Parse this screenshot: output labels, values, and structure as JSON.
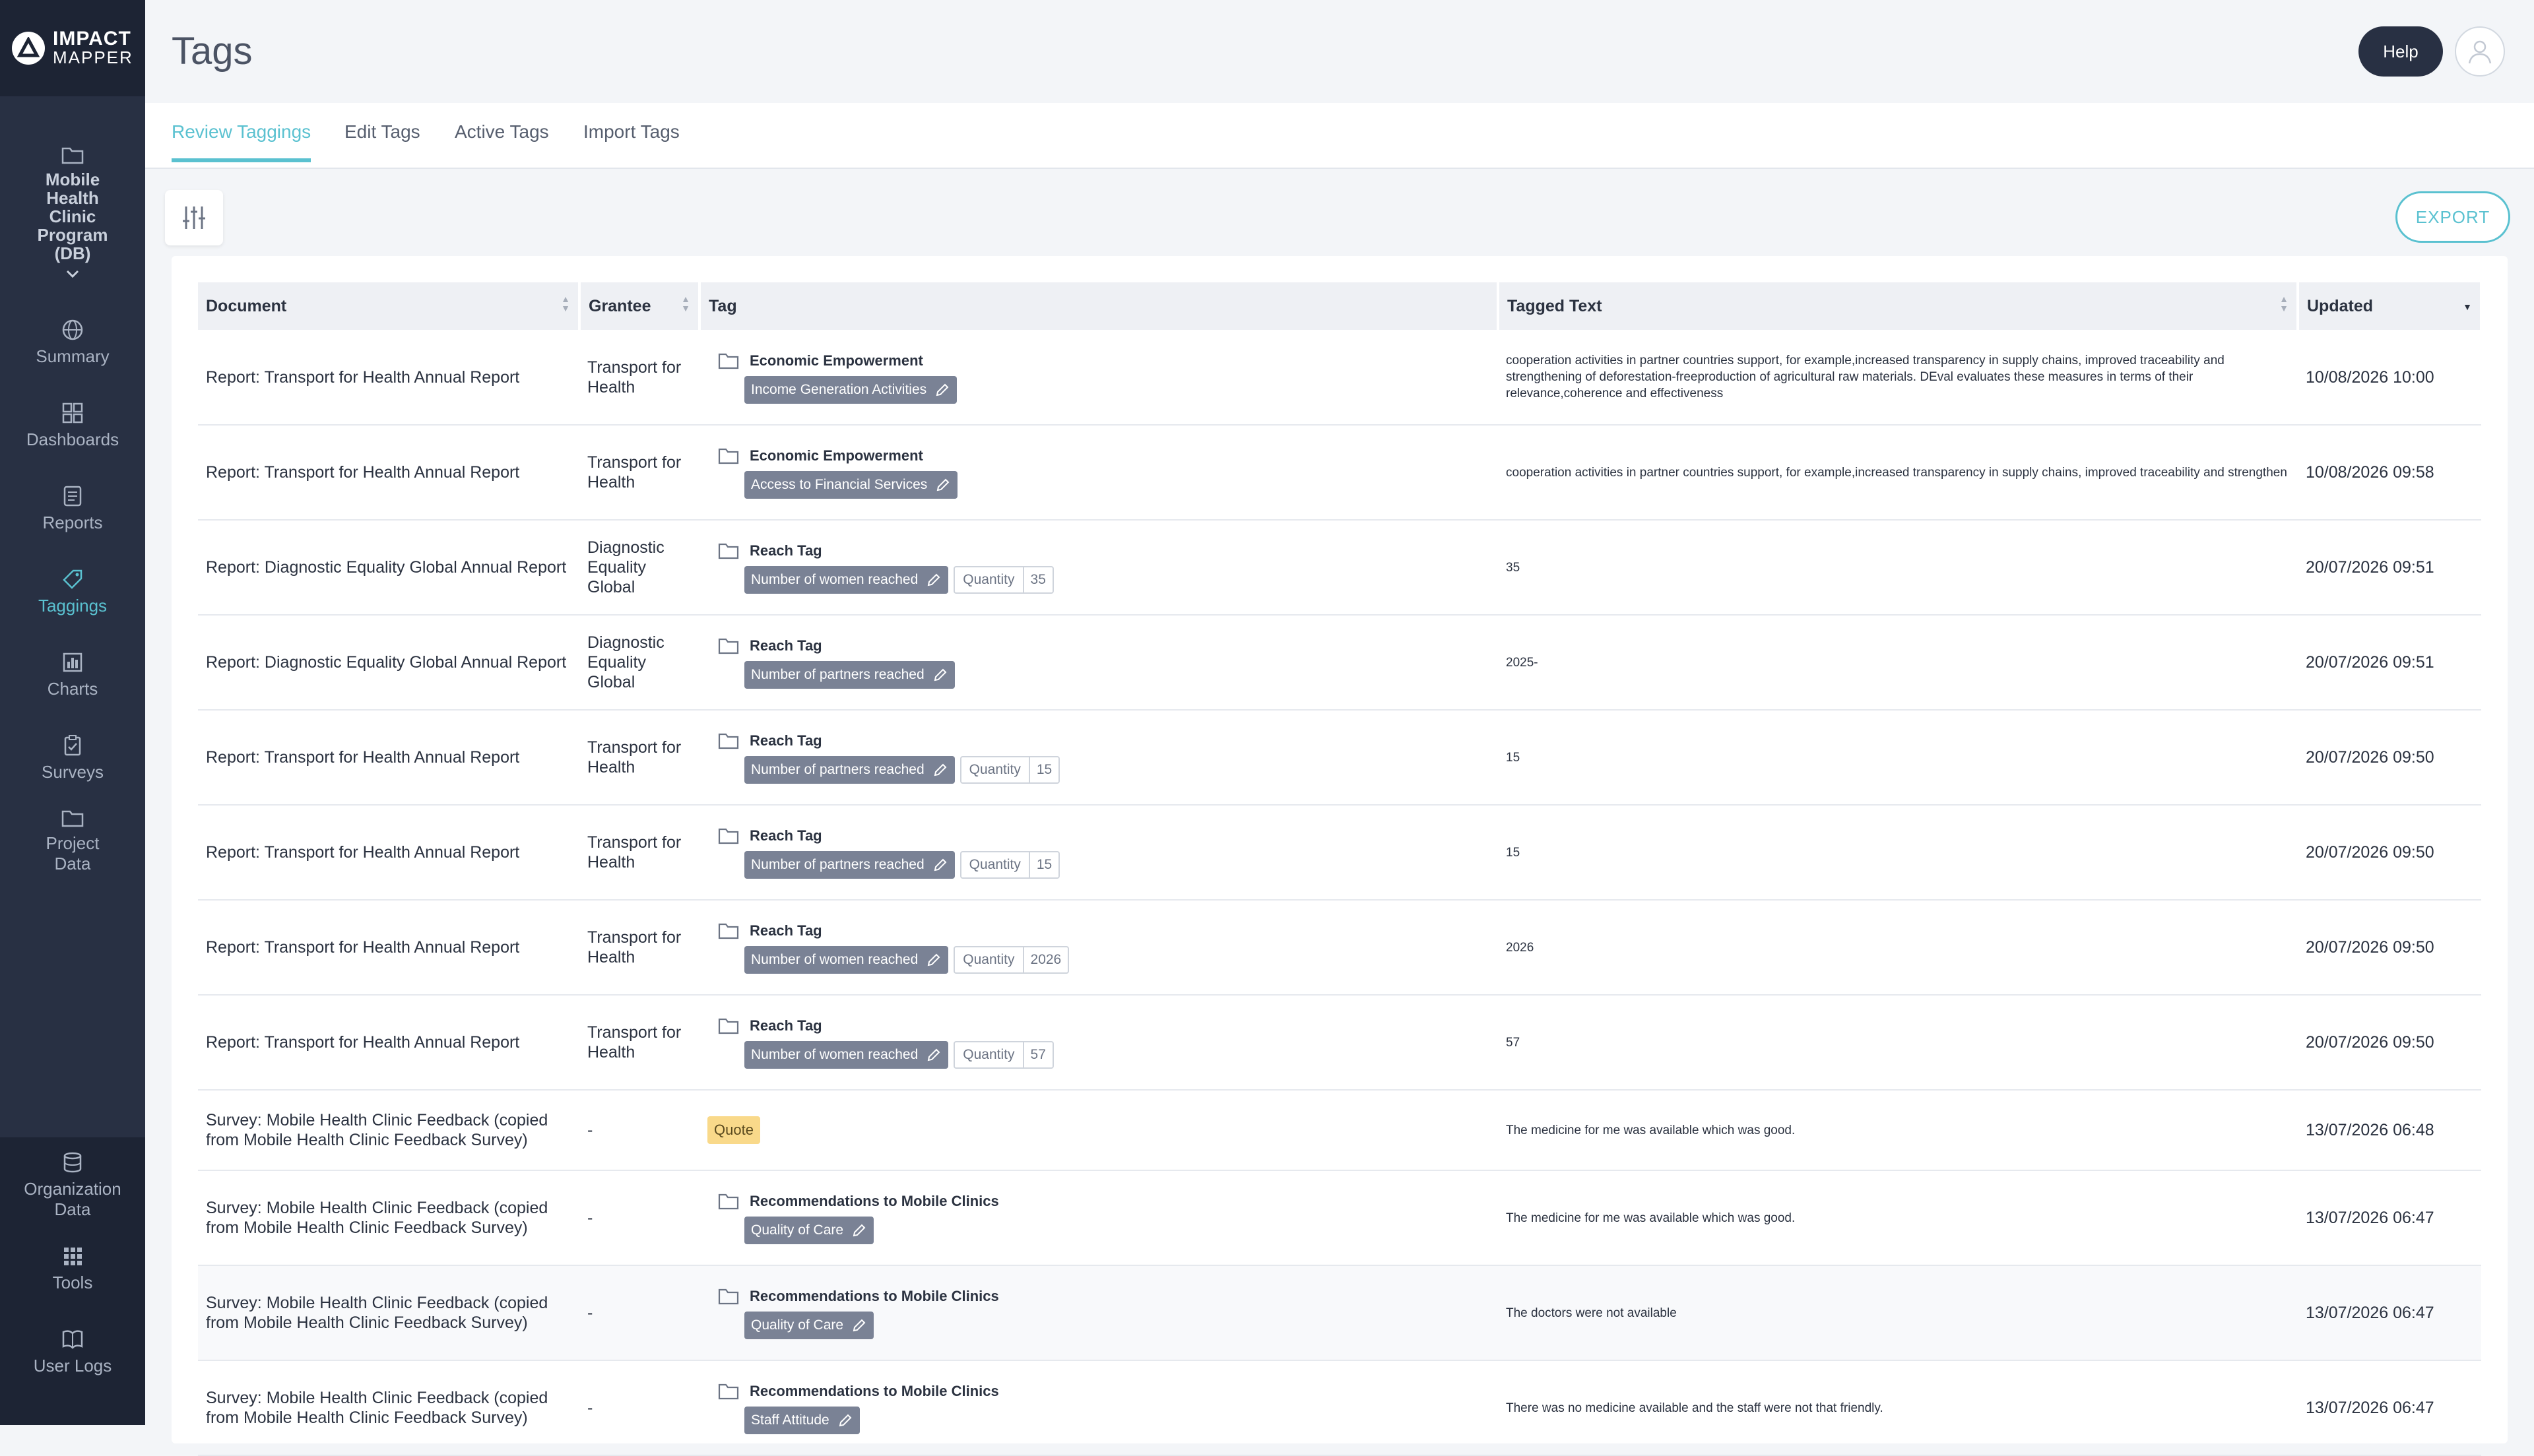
{
  "app": {
    "logo_line1": "IMPACT",
    "logo_line2": "MAPPER",
    "accent_color": "#5ac1d0",
    "sidebar_color": "#283043"
  },
  "sidebar": {
    "program": {
      "label": "Mobile Health Clinic Program (DB)",
      "icon": "folder-icon"
    },
    "items": [
      {
        "label": "Summary",
        "icon": "globe-icon"
      },
      {
        "label": "Dashboards",
        "icon": "dashboard-icon"
      },
      {
        "label": "Reports",
        "icon": "report-icon"
      },
      {
        "label": "Taggings",
        "icon": "tag-icon",
        "active": true
      },
      {
        "label": "Charts",
        "icon": "chart-icon"
      },
      {
        "label": "Surveys",
        "icon": "clipboard-icon"
      },
      {
        "label": "Project Data",
        "icon": "folder-icon"
      }
    ],
    "bottom_items": [
      {
        "label": "Organization Data",
        "icon": "database-icon"
      },
      {
        "label": "Tools",
        "icon": "grid-icon"
      },
      {
        "label": "User Logs",
        "icon": "book-icon"
      }
    ]
  },
  "header": {
    "title": "Tags",
    "help_label": "Help"
  },
  "tabs": [
    {
      "label": "Review Taggings",
      "active": true
    },
    {
      "label": "Edit Tags"
    },
    {
      "label": "Active Tags"
    },
    {
      "label": "Import Tags"
    }
  ],
  "toolbar": {
    "export_label": "EXPORT"
  },
  "table": {
    "columns": [
      "Document",
      "Grantee",
      "Tag",
      "Tagged Text",
      "Updated"
    ],
    "rows": [
      {
        "document": "Report: Transport for Health Annual Report",
        "grantee": "Transport for Health",
        "tag_group": "Economic Empowerment",
        "tag": "Income Generation Activities",
        "quantity_label": "",
        "quantity": "",
        "tagged_text": "cooperation activities in partner countries support, for example,increased transparency in supply chains, improved traceability and strengthening of deforestation-freeproduction of agricultural raw materials. DEval evaluates these measures in terms of their relevance,coherence and effectiveness",
        "updated": "10/08/2026 10:00"
      },
      {
        "document": "Report: Transport for Health Annual Report",
        "grantee": "Transport for Health",
        "tag_group": "Economic Empowerment",
        "tag": "Access to Financial Services",
        "quantity_label": "",
        "quantity": "",
        "tagged_text": "cooperation activities in partner countries support, for example,increased transparency in supply chains, improved traceability and strengthen",
        "updated": "10/08/2026 09:58"
      },
      {
        "document": "Report: Diagnostic Equality Global Annual Report",
        "grantee": "Diagnostic Equality Global",
        "tag_group": "Reach Tag",
        "tag": "Number of women reached",
        "quantity_label": "Quantity",
        "quantity": "35",
        "tagged_text": "35",
        "updated": "20/07/2026 09:51"
      },
      {
        "document": "Report: Diagnostic Equality Global Annual Report",
        "grantee": "Diagnostic Equality Global",
        "tag_group": "Reach Tag",
        "tag": "Number of partners reached",
        "quantity_label": "",
        "quantity": "",
        "tagged_text": "2025-",
        "updated": "20/07/2026 09:51"
      },
      {
        "document": "Report: Transport for Health Annual Report",
        "grantee": "Transport for Health",
        "tag_group": "Reach Tag",
        "tag": "Number of partners reached",
        "quantity_label": "Quantity",
        "quantity": "15",
        "tagged_text": "15",
        "updated": "20/07/2026 09:50"
      },
      {
        "document": "Report: Transport for Health Annual Report",
        "grantee": "Transport for Health",
        "tag_group": "Reach Tag",
        "tag": "Number of partners reached",
        "quantity_label": "Quantity",
        "quantity": "15",
        "tagged_text": "15",
        "updated": "20/07/2026 09:50"
      },
      {
        "document": "Report: Transport for Health Annual Report",
        "grantee": "Transport for Health",
        "tag_group": "Reach Tag",
        "tag": "Number of women reached",
        "quantity_label": "Quantity",
        "quantity": "2026",
        "tagged_text": "2026",
        "updated": "20/07/2026 09:50"
      },
      {
        "document": "Report: Transport for Health Annual Report",
        "grantee": "Transport for Health",
        "tag_group": "Reach Tag",
        "tag": "Number of women reached",
        "quantity_label": "Quantity",
        "quantity": "57",
        "tagged_text": "57",
        "updated": "20/07/2026 09:50"
      },
      {
        "document": "Survey: Mobile Health Clinic Feedback (copied from Mobile Health Clinic Feedback Survey)",
        "grantee": "-",
        "quote": "Quote",
        "tagged_text": "The medicine for me was available which was good.",
        "updated": "13/07/2026 06:48"
      },
      {
        "document": "Survey: Mobile Health Clinic Feedback (copied from Mobile Health Clinic Feedback Survey)",
        "grantee": "-",
        "tag_group": "Recommendations to Mobile Clinics",
        "tag": "Quality of Care",
        "quantity_label": "",
        "quantity": "",
        "tagged_text": "The medicine for me was available which was good.",
        "updated": "13/07/2026 06:47"
      },
      {
        "document": "Survey: Mobile Health Clinic Feedback (copied from Mobile Health Clinic Feedback Survey)",
        "grantee": "-",
        "tag_group": "Recommendations to Mobile Clinics",
        "tag": "Quality of Care",
        "quantity_label": "",
        "quantity": "",
        "tagged_text": "The doctors were not available",
        "updated": "13/07/2026 06:47"
      },
      {
        "document": "Survey: Mobile Health Clinic Feedback (copied from Mobile Health Clinic Feedback Survey)",
        "grantee": "-",
        "tag_group": "Recommendations to Mobile Clinics",
        "tag": "Staff Attitude",
        "quantity_label": "",
        "quantity": "",
        "tagged_text": "There was no medicine available and the staff were not that friendly.",
        "updated": "13/07/2026 06:47"
      }
    ]
  }
}
